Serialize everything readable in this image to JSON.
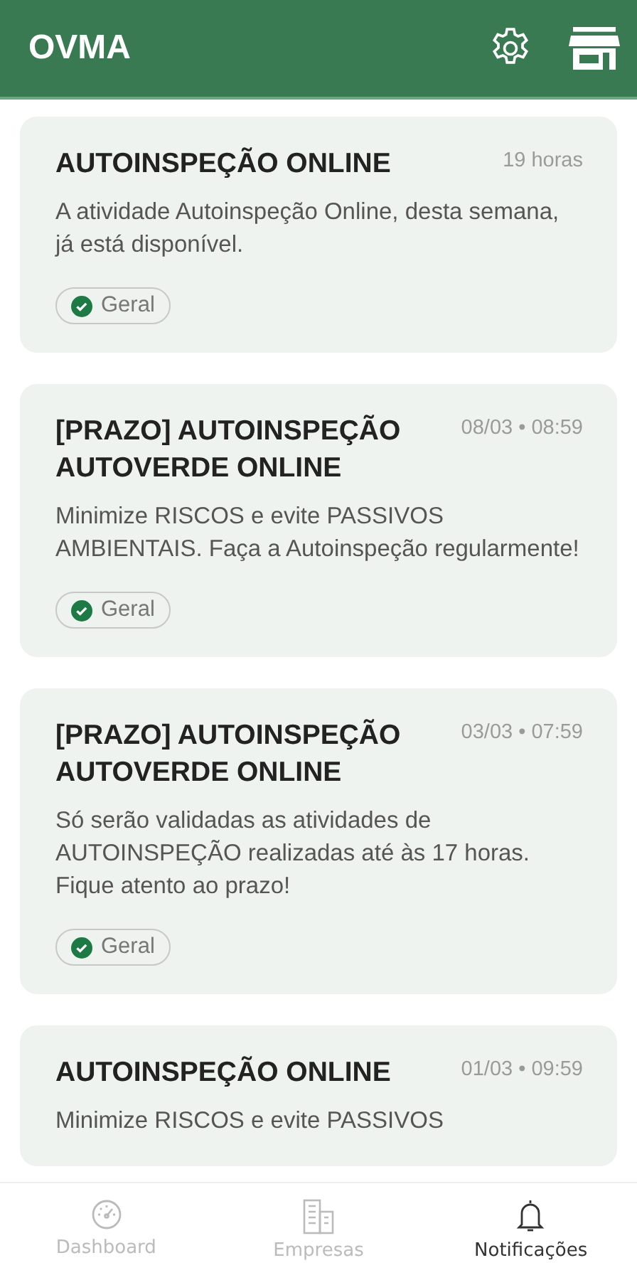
{
  "app_bar": {
    "title": "OVMA"
  },
  "notifications": [
    {
      "title": "AUTOINSPEÇÃO ONLINE",
      "time": "19 horas",
      "body": "A atividade Autoinspeção Online, desta semana, já está disponível.",
      "tag": "Geral"
    },
    {
      "title": "[PRAZO] AUTOINSPEÇÃO AUTOVERDE ONLINE",
      "time": "08/03 • 08:59",
      "body": "Minimize RISCOS e evite PASSIVOS AMBIENTAIS. Faça a Autoinspeção regularmente!",
      "tag": "Geral"
    },
    {
      "title": "[PRAZO] AUTOINSPEÇÃO AUTOVERDE ONLINE",
      "time": "03/03 • 07:59",
      "body": "Só serão validadas as atividades de AUTOINSPEÇÃO realizadas até às 17 horas. Fique atento ao prazo!",
      "tag": "Geral"
    },
    {
      "title": "AUTOINSPEÇÃO ONLINE",
      "time": "01/03 • 09:59",
      "body": "Minimize RISCOS e evite PASSIVOS"
    }
  ],
  "bottom_nav": [
    {
      "label": "Dashboard",
      "kind": "gauge",
      "selected": false
    },
    {
      "label": "Empresas",
      "kind": "building",
      "selected": false
    },
    {
      "label": "Notificações",
      "kind": "bell",
      "selected": true
    }
  ]
}
